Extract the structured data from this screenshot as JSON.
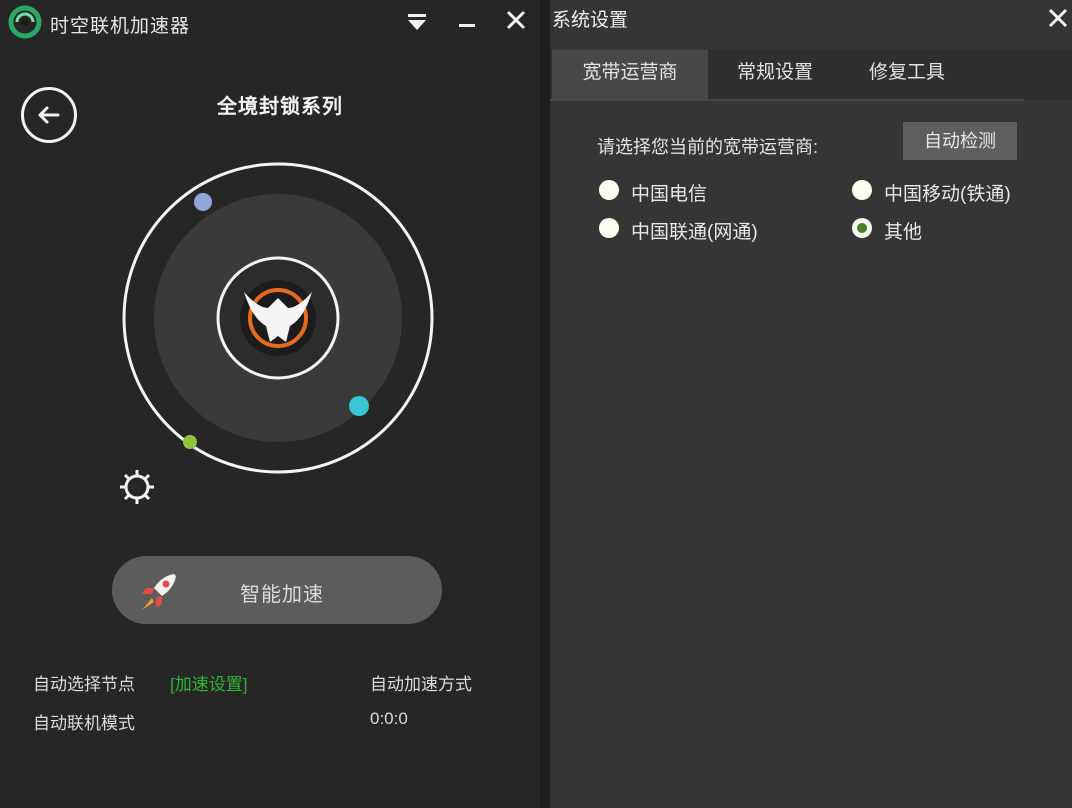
{
  "app": {
    "title": "时空联机加速器"
  },
  "left": {
    "game_title": "全境封锁系列",
    "accelerate_label": "智能加速",
    "info": {
      "auto_node": "自动选择节点",
      "accel_settings_link": "[加速设置]",
      "auto_accel_mode": "自动加速方式",
      "auto_connect_mode": "自动联机模式",
      "timer": "0:0:0"
    }
  },
  "settings": {
    "title": "系统设置",
    "tabs": [
      {
        "label": "宽带运营商",
        "active": true
      },
      {
        "label": "常规设置",
        "active": false
      },
      {
        "label": "修复工具",
        "active": false
      }
    ],
    "prompt": "请选择您当前的宽带运营商:",
    "auto_detect_label": "自动检测",
    "isps": [
      {
        "label": "中国电信",
        "selected": false
      },
      {
        "label": "中国移动(铁通)",
        "selected": false
      },
      {
        "label": "中国联通(网通)",
        "selected": false
      },
      {
        "label": "其他",
        "selected": true
      }
    ]
  },
  "icons": [
    "app-logo-icon",
    "menu-dropdown-icon",
    "minimize-icon",
    "close-icon",
    "back-arrow-icon",
    "game-emblem-icon",
    "gear-icon",
    "rocket-icon"
  ],
  "colors": {
    "accent_green": "#2fb52f",
    "panel_dark": "#262626",
    "panel_right": "#353535",
    "orbit_dot_blue": "#8fa6d8",
    "orbit_dot_cyan": "#39c6d0",
    "orbit_dot_green": "#8fc43a"
  }
}
